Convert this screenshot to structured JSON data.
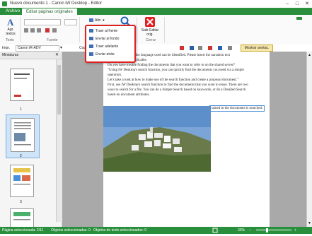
{
  "window": {
    "title": "Nuevo documento 1 - Canon iW Desktop - Editor",
    "minimize": "–",
    "maximize": "□",
    "close": "✕"
  },
  "menu": {
    "file": "Archivo",
    "edit_pages": "Editar páginas originales"
  },
  "ribbon": {
    "add_text": "Agr. textos",
    "group_text": "Texto",
    "group_font": "Fuente",
    "printer_label": "Impr.",
    "printer_value": "Canon iR-ADV",
    "copy_label": "Cop",
    "align_label": "Alin.",
    "exit_label": "Salir Editar orig.",
    "group_close": "Cerrar"
  },
  "dropdown": {
    "items": [
      "Traer al frente",
      "Enviar al fondo",
      "Traer adelante",
      "Enviar atrás"
    ]
  },
  "toolbar2": {
    "show_annotations": "Mostrar anotac."
  },
  "sidebar": {
    "title": "Miniaturas",
    "thumbs": [
      "1",
      "2",
      "3"
    ]
  },
  "document": {
    "lines": [
      "n screen. However, the language used can be identified. Please insert the narration text",
      "uage where applicable.",
      "Do you have trouble finding the documents that you want to refer to on the shared server?",
      "\"Using iW Desktop's search function, you can quickly find the documents you need via a simple",
      "operation.",
      "Let's take a look at how to make use of the search function and create a proposal document.\"",
      "First, use iW Desktop's search function to find the documents that you want to reuse. There are two",
      "ways to search for a file. You can do a Simple Search based on keywords, or do a Detailed Search",
      "based on document attributes."
    ],
    "highlight_text": "tained in the documents is searched."
  },
  "status": {
    "page_selected": "Página seleccionada: 2/11",
    "objects_selected": "Objetos seleccionados: 0",
    "text_objects": "Objetos de texto seleccionados: 0",
    "zoom": "33%"
  },
  "colors": {
    "accent": "#2a8f3c",
    "dropdown_border": "#e02020"
  }
}
